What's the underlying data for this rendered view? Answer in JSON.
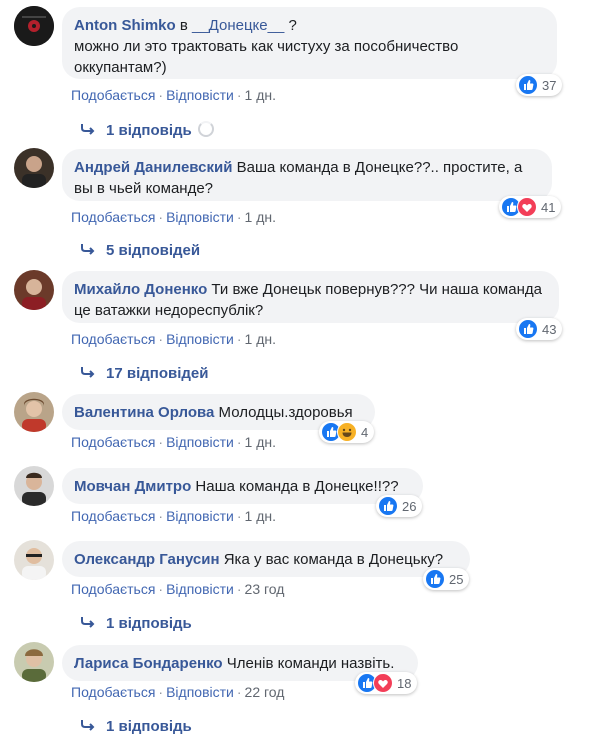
{
  "actions": {
    "like": "Подобається",
    "reply": "Відповісти",
    "sep": "·"
  },
  "comments": [
    {
      "author": "Anton Shimko",
      "prefix": " в ",
      "mention": "__Донецке__",
      "suffix": " ?",
      "text": "можно ли это трактовать как чистуху за пособничество оккупантам?)",
      "time": "1 дн.",
      "reactions": [
        "like"
      ],
      "count": "37",
      "replies": "1 відповідь",
      "loading": true
    },
    {
      "author": "Андрей Данилевский",
      "text": " Ваша команда в Донецке??.. простите, а вы в чьей команде?",
      "time": "1 дн.",
      "reactions": [
        "like",
        "love"
      ],
      "count": "41",
      "replies": "5 відповідей"
    },
    {
      "author": "Михайло Доненко",
      "text": " Ти вже Донецьк повернув??? Чи наша команда це ватажки недореспублік?",
      "time": "1 дн.",
      "reactions": [
        "like"
      ],
      "count": "43",
      "replies": "17 відповідей"
    },
    {
      "author": "Валентина Орлова",
      "text": " Молодцы.здоровья",
      "time": "1 дн.",
      "reactions": [
        "like",
        "haha"
      ],
      "count": "4"
    },
    {
      "author": "Мовчан Дмитро",
      "text": " Наша команда в Донецке!!??",
      "time": "1 дн.",
      "reactions": [
        "like"
      ],
      "count": "26"
    },
    {
      "author": "Олександр Ганусин",
      "text": " Яка у вас команда в Донецьку?",
      "time": "23 год",
      "reactions": [
        "like"
      ],
      "count": "25",
      "replies": "1 відповідь"
    },
    {
      "author": "Лариса Бондаренко",
      "text": " Членів команди назвіть.",
      "time": "22 год",
      "reactions": [
        "like",
        "love"
      ],
      "count": "18",
      "replies": "1 відповідь"
    }
  ]
}
